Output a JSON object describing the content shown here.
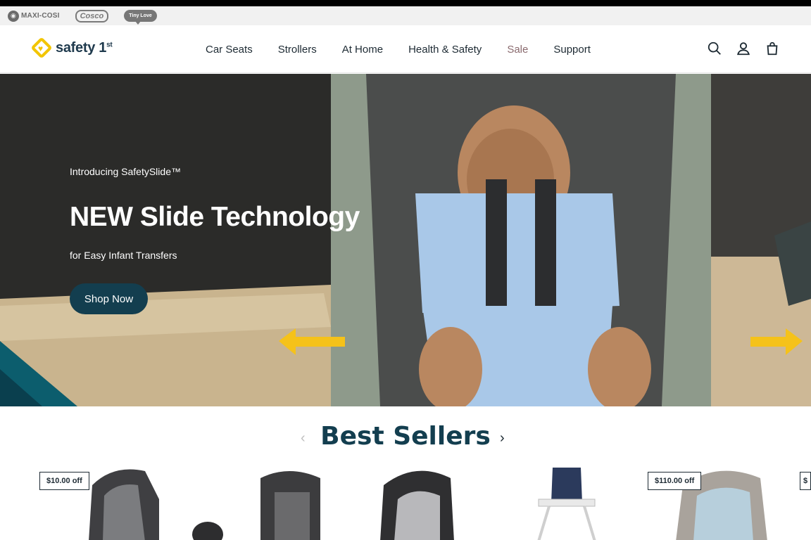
{
  "brands": {
    "maxi": "MAXI-COSI",
    "cosco": "Cosco",
    "tiny": "Tiny Love"
  },
  "header": {
    "logo_text": "safety 1",
    "logo_sup": "st",
    "nav": [
      {
        "label": "Car Seats"
      },
      {
        "label": "Strollers"
      },
      {
        "label": "At Home"
      },
      {
        "label": "Health & Safety"
      },
      {
        "label": "Sale"
      },
      {
        "label": "Support"
      }
    ],
    "icons": [
      "search-icon",
      "account-icon",
      "bag-icon"
    ]
  },
  "hero": {
    "eyebrow": "Introducing SafetySlide™",
    "title": "NEW Slide Technology",
    "subtitle": "for Easy Infant Transfers",
    "cta": "Shop Now"
  },
  "best_sellers": {
    "title": "Best Sellers",
    "products": [
      {
        "badge": "$10.00 off"
      },
      {
        "badge": ""
      },
      {
        "badge": ""
      },
      {
        "badge": ""
      },
      {
        "badge": "$110.00 off"
      },
      {
        "badge": "$"
      }
    ]
  },
  "colors": {
    "brand_navy": "#133e4f",
    "accent_yellow": "#f2c500",
    "sale_text": "#8a6a6e"
  }
}
